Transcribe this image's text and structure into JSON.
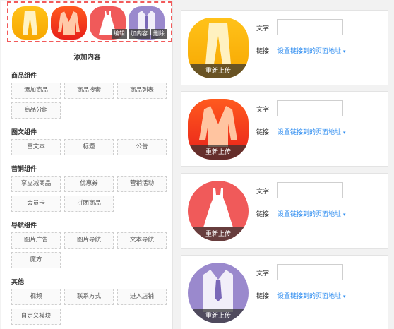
{
  "preview": {
    "icons": [
      {
        "name": "pants",
        "color_top": "#ffc21a",
        "color_bottom": "#f7a700"
      },
      {
        "name": "jacket",
        "color_top": "#ff5a1e",
        "color_bottom": "#e8201a"
      },
      {
        "name": "dress",
        "color_top": "#f25d5d",
        "color_bottom": "#e84848"
      },
      {
        "name": "shirt",
        "color_top": "#a999d6",
        "color_bottom": "#8b79c4"
      }
    ],
    "ops": {
      "edit": "编辑",
      "add_content": "加内容",
      "delete": "删除"
    }
  },
  "panel": {
    "title": "添加内容",
    "groups": [
      {
        "title": "商品组件",
        "items": [
          "添加商品",
          "商品搜索",
          "商品列表",
          "商品分组"
        ]
      },
      {
        "title": "图文组件",
        "items": [
          "富文本",
          "标题",
          "公告"
        ]
      },
      {
        "title": "营销组件",
        "items": [
          "享立减商品",
          "优惠券",
          "营销活动",
          "会员卡",
          "拼团商品"
        ]
      },
      {
        "title": "导航组件",
        "items": [
          "图片广告",
          "图片导航",
          "文本导航",
          "魔方"
        ]
      },
      {
        "title": "其他",
        "items": [
          "视频",
          "联系方式",
          "进入店铺",
          "自定义模块"
        ]
      }
    ]
  },
  "editor": {
    "reupload_label": "重新上传",
    "text_label": "文字:",
    "link_label": "链接:",
    "link_value": "设置链接到的页面地址",
    "caret": "▾",
    "items": [
      {
        "icon": "pants-icon",
        "text_value": ""
      },
      {
        "icon": "jacket-icon",
        "text_value": ""
      },
      {
        "icon": "dress-icon",
        "text_value": ""
      },
      {
        "icon": "shirt-icon",
        "text_value": ""
      }
    ]
  },
  "colors": {
    "accent": "#2d8cf0",
    "selection_border": "#f25a5a"
  }
}
